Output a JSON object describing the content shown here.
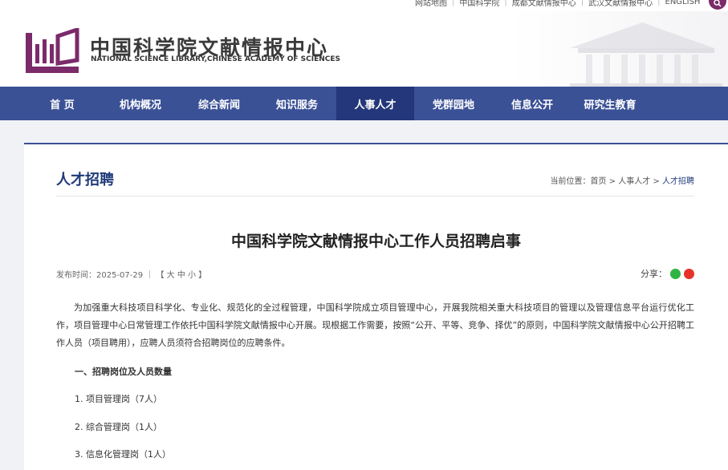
{
  "top_links": [
    "网站地图",
    "中国科学院",
    "成都文献情报中心",
    "武汉文献情报中心",
    "ENGLISH"
  ],
  "logo": {
    "cn": "中国科学院文献情报中心",
    "en": "NATIONAL SCIENCE LIBRARY,CHINESE ACADEMY OF SCIENCES"
  },
  "nav": [
    {
      "label": "首  页"
    },
    {
      "label": "机构概况"
    },
    {
      "label": "综合新闻"
    },
    {
      "label": "知识服务"
    },
    {
      "label": "人事人才",
      "active": true
    },
    {
      "label": "党群园地"
    },
    {
      "label": "信息公开"
    },
    {
      "label": "研究生教育"
    }
  ],
  "section": {
    "title": "人才招聘",
    "breadcrumb": {
      "prefix": "当前位置：",
      "items": [
        "首页",
        "人事人才",
        "人才招聘"
      ],
      "sep": " > "
    }
  },
  "article": {
    "title": "中国科学院文献情报中心工作人员招聘启事",
    "meta": "发布时间：2025-07-29  ｜  【 大  中  小 】",
    "share_label": "分享：",
    "intro": "为加强重大科技项目科学化、专业化、规范化的全过程管理，中国科学院成立项目管理中心，开展我院相关重大科技项目的管理以及管理信息平台运行优化工作，项目管理中心日常管理工作依托中国科学院文献情报中心开展。现根据工作需要，按照“公开、平等、竞争、择优”的原则，中国科学院文献情报中心公开招聘工作人员（项目聘用），应聘人员须符合招聘岗位的应聘条件。",
    "heading1": "一、招聘岗位及人员数量",
    "items": [
      "1. 项目管理岗（7人）",
      "2. 综合管理岗（1人）",
      "3. 信息化管理岗（1人）"
    ]
  },
  "colors": {
    "nav_bg": "#3b5196",
    "nav_active": "#23377a",
    "brand_purple": "#7b2a6a",
    "title_blue": "#1f3a7a"
  }
}
